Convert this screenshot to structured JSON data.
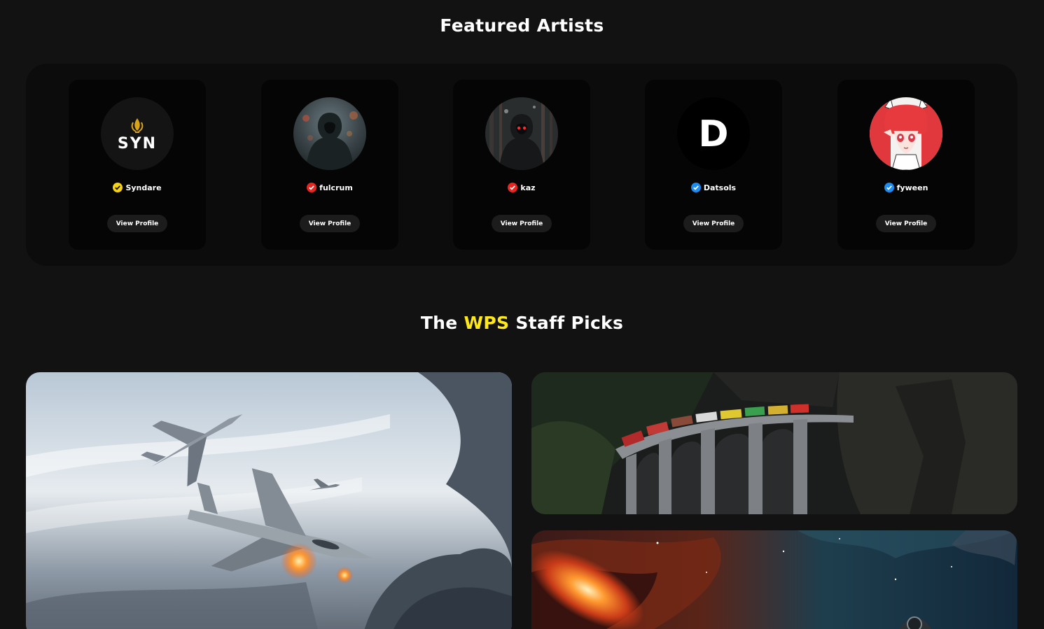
{
  "featured": {
    "title": "Featured Artists",
    "artists": [
      {
        "name": "Syndare",
        "badge_color": "#f5d312",
        "avatar_icon": "syn-logo",
        "avatar_text": "SYN",
        "button": "View Profile"
      },
      {
        "name": "fulcrum",
        "badge_color": "#e8251f",
        "avatar_icon": "hooded-figure-photo",
        "button": "View Profile"
      },
      {
        "name": "kaz",
        "badge_color": "#e8251f",
        "avatar_icon": "hooded-figure-red-eyes-photo",
        "button": "View Profile"
      },
      {
        "name": "Datsols",
        "badge_color": "#1d8cf0",
        "avatar_icon": "d-letter-logo",
        "avatar_text": "D",
        "button": "View Profile"
      },
      {
        "name": "fyween",
        "badge_color": "#1d8cf0",
        "avatar_icon": "anime-girl-illustration",
        "button": "View Profile"
      }
    ]
  },
  "staff_picks": {
    "title_before": "The ",
    "title_accent": "WPS",
    "title_after": " Staff Picks",
    "accent_color": "#ffe81a",
    "images": [
      {
        "subject": "fighter-jets-in-sky"
      },
      {
        "subject": "train-on-viaduct"
      },
      {
        "subject": "space-nebula-astronaut"
      }
    ]
  }
}
